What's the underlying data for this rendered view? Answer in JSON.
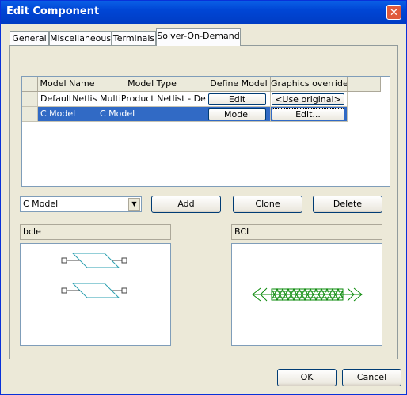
{
  "window": {
    "title": "Edit Component",
    "close_glyph": "✕"
  },
  "tabs": [
    "General",
    "Miscellaneous",
    "Terminals",
    "Solver-On-Demand"
  ],
  "active_tab": "Solver-On-Demand",
  "table": {
    "columns": [
      "Model Name",
      "Model Type",
      "Define Model",
      "Graphics overrides"
    ],
    "rows": [
      {
        "name": "DefaultNetlist",
        "type": "MultiProduct Netlist - Default",
        "define": "Edit",
        "graphics": "<Use original>"
      },
      {
        "name": "C Model",
        "type": "C Model",
        "define": "Model",
        "graphics": "Edit..."
      }
    ],
    "selected_row": 1
  },
  "model_select": {
    "value": "C Model",
    "arrow_icon": "chevron-down-icon"
  },
  "buttons": {
    "add": "Add",
    "clone": "Clone",
    "delete": "Delete",
    "ok": "OK",
    "cancel": "Cancel"
  },
  "left_preview": {
    "label": "bcle"
  },
  "right_preview": {
    "label": "BCL"
  },
  "colors": {
    "titlebar": "#0046d5",
    "selection": "#316ac5",
    "left_symbol": "#2a9fb0",
    "right_symbol": "#0a8a0a"
  }
}
